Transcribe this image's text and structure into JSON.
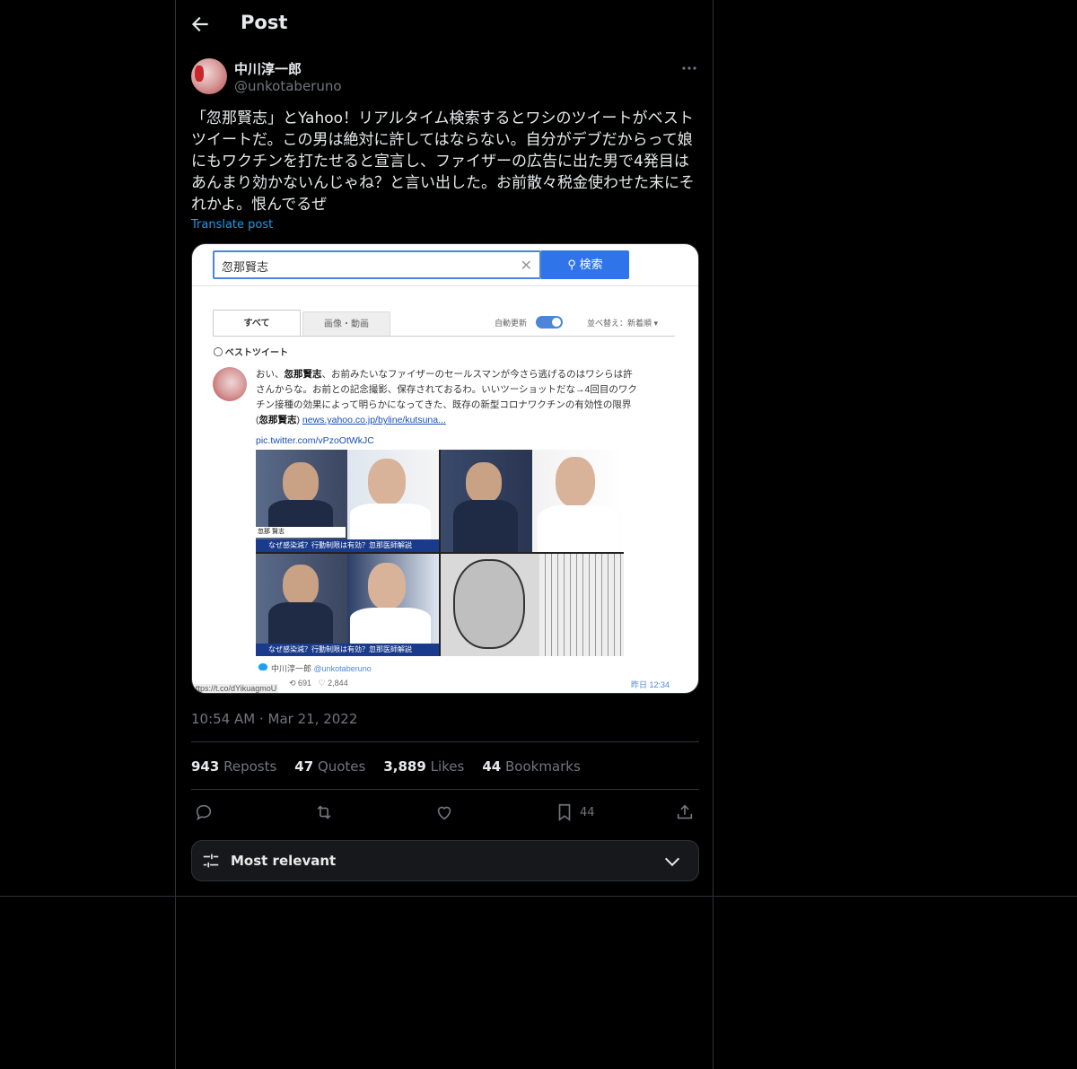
{
  "header": {
    "title": "Post"
  },
  "post": {
    "author_name": "中川淳一郎",
    "author_handle": "@unkotaberuno",
    "text": "「忽那賢志」とYahoo！リアルタイム検索するとワシのツイートがベストツイートだ。この男は絶対に許してはならない。自分がデブだからって娘にもワクチンを打たせると宣言し、ファイザーの広告に出た男で4発目はあんまり効かないんじゃね？と言い出した。お前散々税金使わせた末にそれかよ。恨んでるぜ",
    "translate_label": "Translate post",
    "timestamp": "10:54 AM · Mar 21, 2022"
  },
  "media": {
    "search_value": "忽那賢志",
    "search_button": "検索",
    "tab_all": "すべて",
    "tab_images": "画像・動画",
    "auto_update": "自動更新",
    "sort_label": "並べ替え：新着順 ▾",
    "best_tweet": "ベストツイート",
    "tweet_pre": "おい、",
    "tweet_bold1": "忽那賢志",
    "tweet_mid": "、お前みたいなファイザーのセールスマンが今さら逃げるのはワシらは許さんからな。お前との記念撮影、保存されておるわ。いいツーショットだな→4回目のワクチン接種の効果によって明らかになってきた、既存の新型コロナワクチンの有効性の限界(",
    "tweet_bold2": "忽那賢志",
    "tweet_post": ") ",
    "tweet_link": "news.yahoo.co.jp/byline/kutsuna...",
    "pic_link": "pic.twitter.com/vPzoOtWkJC",
    "caption_banner": "なぜ感染減？行動制限は有効？忽那医師解説",
    "caption_name": "忽那 賢志",
    "footer_name": "中川淳一郎",
    "footer_handle": "@unkotaberuno",
    "footer_retweets": "691",
    "footer_likes": "2,844",
    "footer_time": "昨日 12:34",
    "url_overlay": "ttps://t.co/dYikuagmoU"
  },
  "stats": {
    "reposts_count": "943",
    "reposts_label": "Reposts",
    "quotes_count": "47",
    "quotes_label": "Quotes",
    "likes_count": "3,889",
    "likes_label": "Likes",
    "bookmarks_count": "44",
    "bookmarks_label": "Bookmarks"
  },
  "actions": {
    "bookmark_count": "44",
    "icons": [
      "reply-icon",
      "repost-icon",
      "like-icon",
      "bookmark-icon",
      "share-icon"
    ]
  },
  "replies_sort": {
    "label": "Most relevant"
  },
  "colors": {
    "accent": "#1d9bf0",
    "background": "#000000",
    "muted": "#71767b",
    "border": "#2f3336"
  }
}
